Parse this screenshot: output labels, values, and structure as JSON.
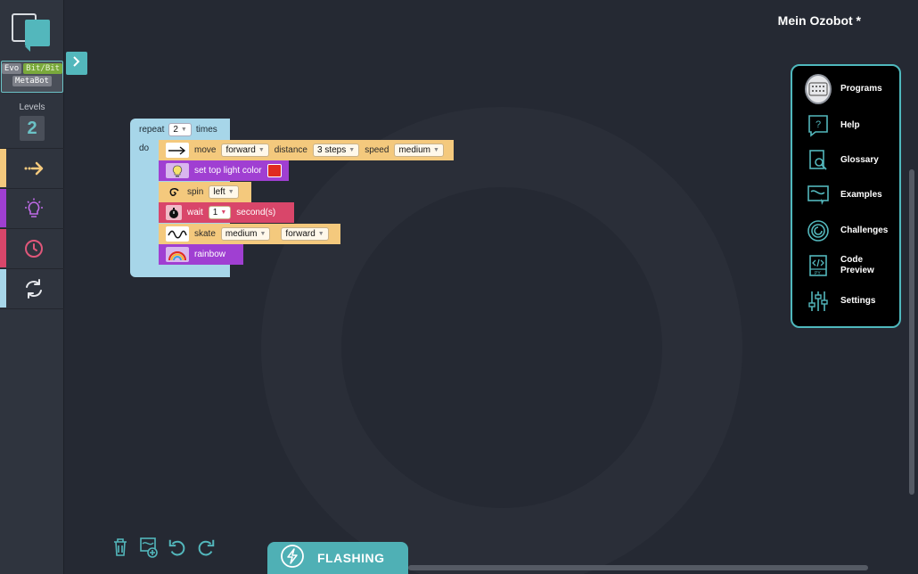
{
  "program": {
    "title": "Mein Ozobot *"
  },
  "robots": {
    "evo": "Evo",
    "bit": "Bit/Bit",
    "meta": "MetaBot"
  },
  "levels": {
    "label": "Levels",
    "value": "2"
  },
  "categories": [
    {
      "name": "movement",
      "icon": "arrow-right-icon",
      "color": "#f4c97d"
    },
    {
      "name": "light-effects",
      "icon": "light-bulb-icon",
      "color": "#a03fd2"
    },
    {
      "name": "timing",
      "icon": "clock-icon",
      "color": "#d9466a"
    },
    {
      "name": "loops",
      "icon": "refresh-icon",
      "color": "#a7d6e9"
    }
  ],
  "menu": {
    "programs": "Programs",
    "help": "Help",
    "glossary": "Glossary",
    "examples": "Examples",
    "challenges": "Challenges",
    "code_preview": "Code\nPreview",
    "settings": "Settings"
  },
  "blocks": {
    "repeat": {
      "label": "repeat",
      "count": "2",
      "suffix": "times",
      "do": "do"
    },
    "move": {
      "label": "move",
      "direction": "forward",
      "distance_label": "distance",
      "distance": "3 steps",
      "speed_label": "speed",
      "speed": "medium"
    },
    "top_light": {
      "label": "set top light color",
      "color": "#e02b1f"
    },
    "spin": {
      "label": "spin",
      "direction": "left"
    },
    "wait": {
      "label": "wait",
      "value": "1",
      "unit": "second(s)"
    },
    "skate": {
      "label": "skate",
      "speed": "medium",
      "direction": "forward"
    },
    "rainbow": {
      "label": "rainbow"
    }
  },
  "toolbar": {
    "flash": "FLASHING"
  }
}
